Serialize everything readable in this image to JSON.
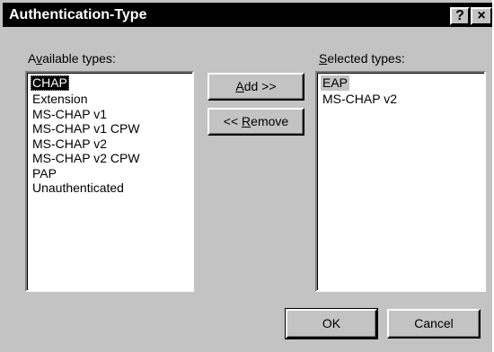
{
  "window": {
    "title": "Authentication-Type",
    "help_label": "?",
    "close_label": "×"
  },
  "available": {
    "label_pre": "A",
    "label_key": "v",
    "label_post": "ailable types:",
    "items": [
      "CHAP",
      "Extension",
      "MS-CHAP v1",
      "MS-CHAP v1 CPW",
      "MS-CHAP v2",
      "MS-CHAP v2 CPW",
      "PAP",
      "Unauthenticated"
    ],
    "selected_item": "CHAP"
  },
  "selected": {
    "label_key": "S",
    "label_post": "elected types:",
    "items": [
      "EAP",
      "MS-CHAP v2"
    ],
    "highlighted_item": "EAP"
  },
  "buttons": {
    "add_key": "A",
    "add_post": "dd >>",
    "remove_pre": "<< ",
    "remove_key": "R",
    "remove_post": "emove",
    "ok": "OK",
    "cancel": "Cancel"
  }
}
